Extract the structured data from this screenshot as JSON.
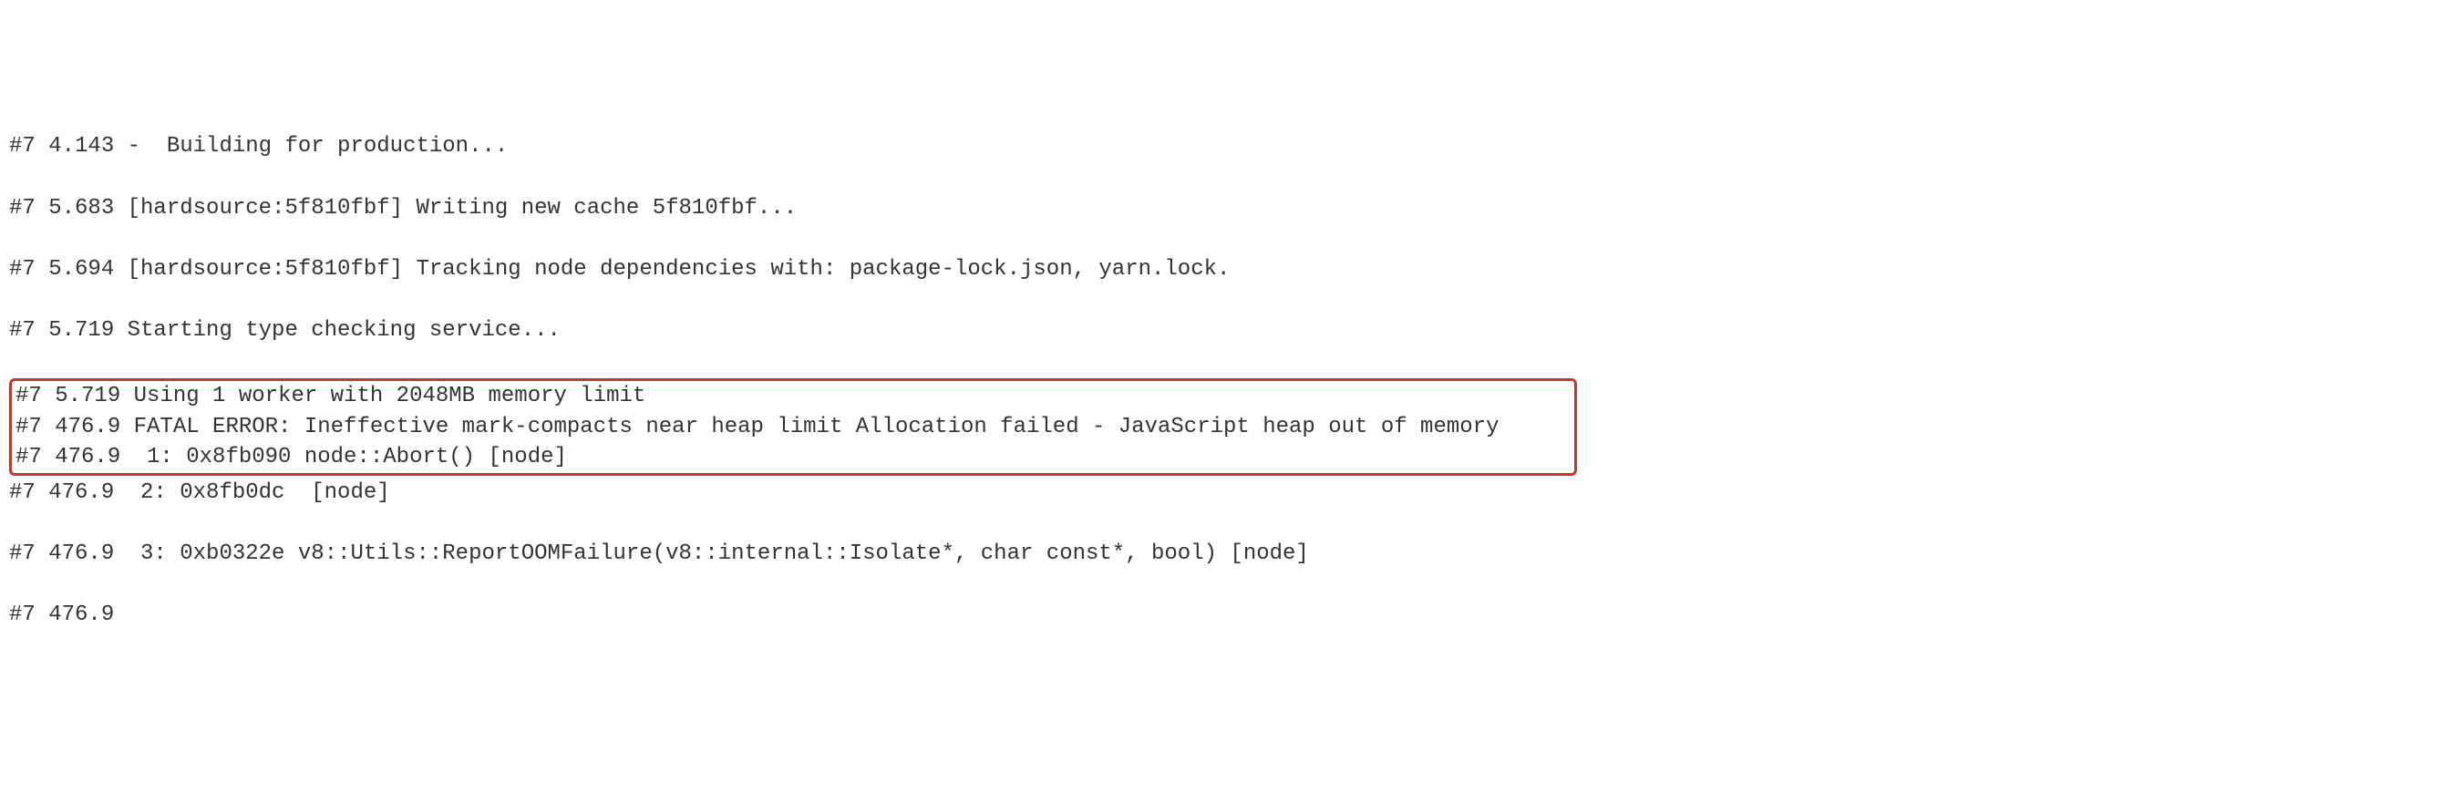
{
  "log": {
    "lines": [
      "#7 4.143 -  Building for production...",
      "#7 5.683 [hardsource:5f810fbf] Writing new cache 5f810fbf...",
      "#7 5.694 [hardsource:5f810fbf] Tracking node dependencies with: package-lock.json, yarn.lock.",
      "#7 5.719 Starting type checking service..."
    ],
    "highlighted": [
      "#7 5.719 Using 1 worker with 2048MB memory limit",
      "#7 476.9 FATAL ERROR: Ineffective mark-compacts near heap limit Allocation failed - JavaScript heap out of memory",
      "#7 476.9  1: 0x8fb090 node::Abort() [node]"
    ],
    "lines_after": [
      "#7 476.9  2: 0x8fb0dc  [node]",
      "#7 476.9  3: 0xb0322e v8::Utils::ReportOOMFailure(v8::internal::Isolate*, char const*, bool) [node]",
      "#7 476.9"
    ]
  }
}
